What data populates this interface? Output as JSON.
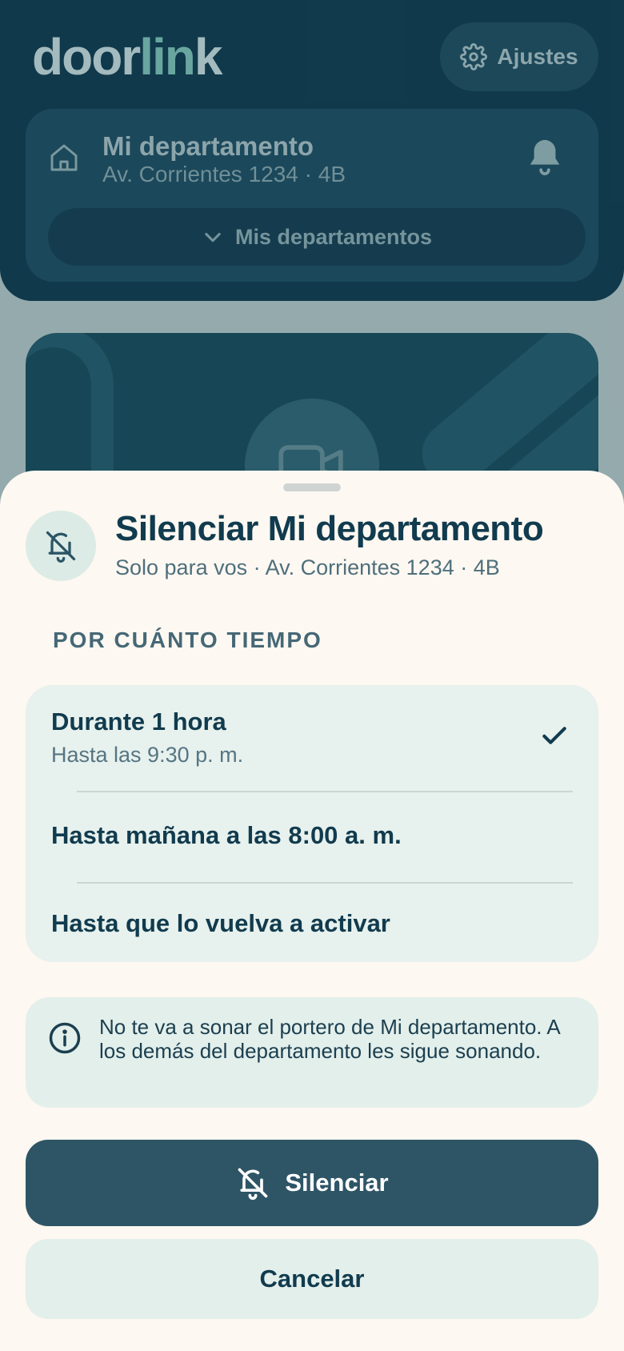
{
  "app": {
    "logo_part1": "door",
    "logo_accent": "lin",
    "logo_part2": "k",
    "settings_label": "Ajustes"
  },
  "apartment": {
    "name": "Mi departamento",
    "address": "Av. Corrientes 1234 · 4B",
    "switch_label": "Mis departamentos"
  },
  "sheet": {
    "title": "Silenciar Mi departamento",
    "subtitle": "Solo para vos · Av. Corrientes 1234 · 4B",
    "section_label": "POR CUÁNTO TIEMPO",
    "options": [
      {
        "title": "Durante 1 hora",
        "subtitle": "Hasta las 9:30 p. m.",
        "selected": true
      },
      {
        "title": "Hasta mañana a las 8:00 a. m.",
        "selected": false
      },
      {
        "title": "Hasta que lo vuelva a activar",
        "selected": false
      }
    ],
    "info_text": "No te va a sonar el portero de Mi departamento. A los demás del departamento les sigue sonando.",
    "primary_button": "Silenciar",
    "secondary_button": "Cancelar"
  },
  "icons": {
    "settings": "gear-icon",
    "home": "home-icon",
    "bell": "bell-icon",
    "chevron": "chevron-down-icon",
    "camera": "video-camera-icon",
    "mute": "bell-off-icon",
    "check": "check-icon",
    "info": "info-icon"
  },
  "colors": {
    "header": "#123c4f",
    "sheet_bg": "#fdf8f1",
    "primary_button": "#2e5566",
    "option_bg": "#e7f1ed",
    "text_dark": "#113b4e"
  }
}
